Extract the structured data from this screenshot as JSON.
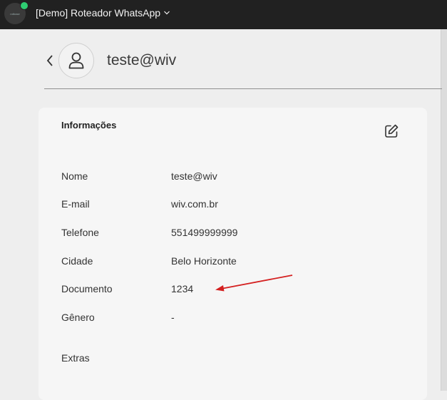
{
  "topbar": {
    "logo_text": "rotbase",
    "workspace_name": "[Demo] Roteador WhatsApp",
    "status_color": "#2ecc71"
  },
  "contact": {
    "name": "teste@wiv"
  },
  "card": {
    "title": "Informações",
    "fields": [
      {
        "label": "Nome",
        "value": "teste@wiv"
      },
      {
        "label": "E-mail",
        "value": "wiv.com.br"
      },
      {
        "label": "Telefone",
        "value": "551499999999"
      },
      {
        "label": "Cidade",
        "value": "Belo Horizonte"
      },
      {
        "label": "Documento",
        "value": "1234"
      },
      {
        "label": "Gênero",
        "value": "-"
      }
    ],
    "extras_label": "Extras"
  },
  "annotation": {
    "arrow_color": "#d42020"
  }
}
